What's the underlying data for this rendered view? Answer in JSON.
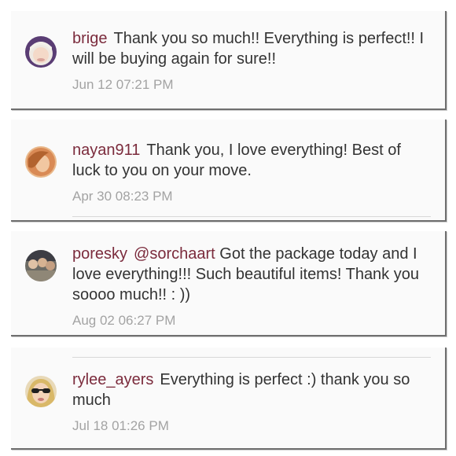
{
  "comments": [
    {
      "username": "brige",
      "mention": "",
      "text": "Thank you so much!! Everything is perfect!!  I will be buying again for sure!!",
      "time": "Jun 12 07:21 PM",
      "avatar_icon": "user-avatar-blonde"
    },
    {
      "username": "nayan911",
      "mention": "",
      "text": "Thank you, I love everything! Best of luck to you on your move.",
      "time": "Apr 30 08:23 PM",
      "avatar_icon": "user-avatar-redhead"
    },
    {
      "username": "poresky",
      "mention": "@sorchaart",
      "text": " Got the package today and I love everything!!! Such beautiful items! Thank you soooo much!! : ))",
      "time": "Aug 02 06:27 PM",
      "avatar_icon": "user-avatar-group"
    },
    {
      "username": "rylee_ayers",
      "mention": "",
      "text": "Everything is perfect :) thank you so much",
      "time": "Jul 18 01:26 PM",
      "avatar_icon": "user-avatar-sunglasses"
    }
  ],
  "colors": {
    "username": "#7b2b3c",
    "text": "#333333",
    "timestamp": "#a3a3a3",
    "card_background": "#fafafa"
  }
}
